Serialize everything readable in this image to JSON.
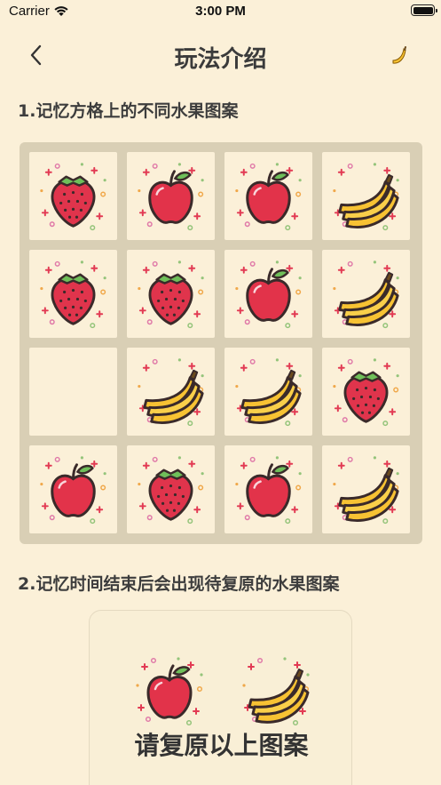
{
  "status_bar": {
    "carrier": "Carrier",
    "time": "3:00 PM"
  },
  "nav": {
    "title": "玩法介绍",
    "back_icon": "chevron-left-icon",
    "action_icon": "banana-icon"
  },
  "steps": [
    {
      "text": "1.记忆方格上的不同水果图案"
    },
    {
      "text": "2.记忆时间结束后会出现待复原的水果图案"
    }
  ],
  "board": {
    "rows": [
      [
        "strawberry",
        "apple",
        "apple",
        "banana"
      ],
      [
        "strawberry",
        "strawberry",
        "apple",
        "banana"
      ],
      [
        "empty",
        "banana",
        "banana",
        "strawberry"
      ],
      [
        "apple",
        "strawberry",
        "apple",
        "banana"
      ]
    ]
  },
  "recall": {
    "items": [
      "apple",
      "banana"
    ],
    "label": "请复原以上图案"
  },
  "colors": {
    "background": "#fbf0d8",
    "board": "#d9cfb5",
    "tile": "#fbf0d8",
    "text": "#3b3b3b"
  }
}
